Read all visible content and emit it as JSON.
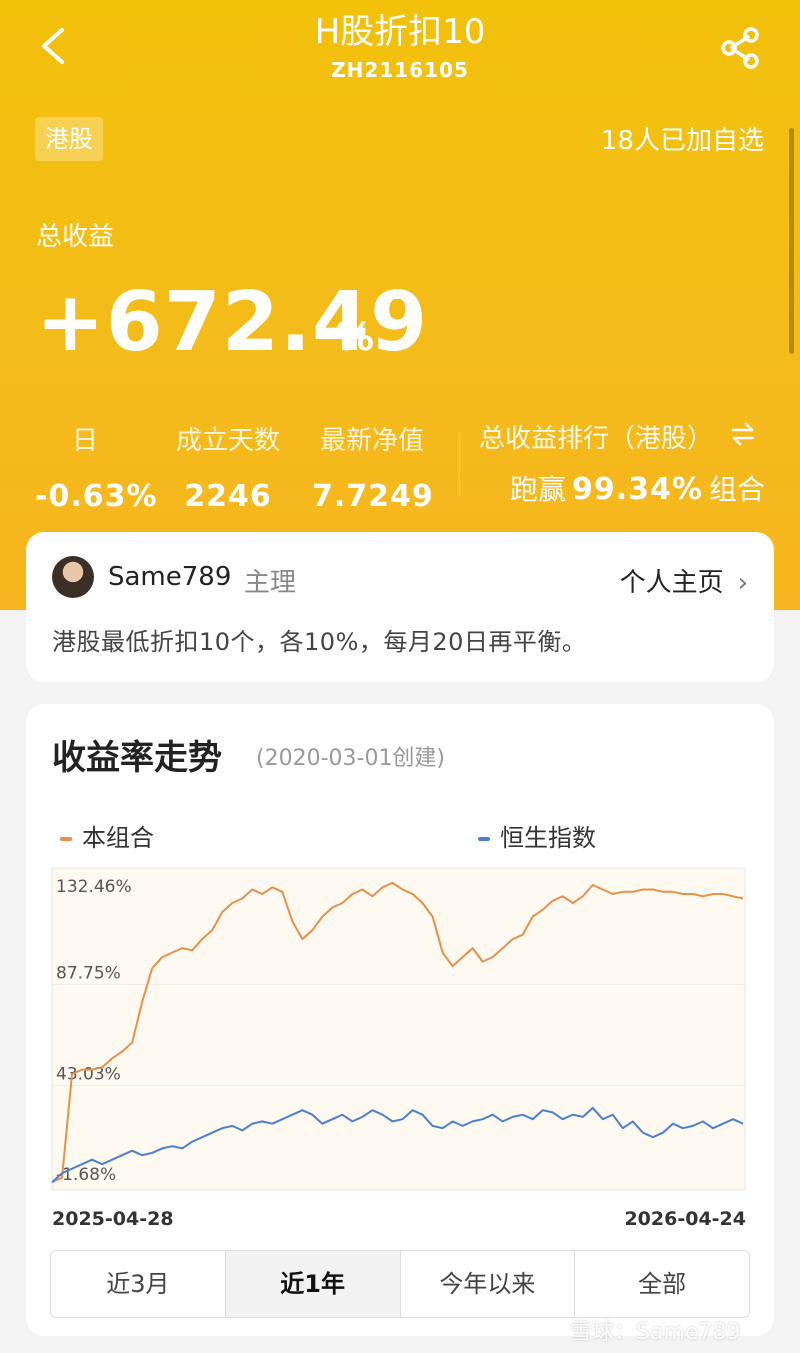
{
  "header": {
    "title": "H股折扣10",
    "code": "ZH2116105",
    "market_tag": "港股",
    "followers": "18人已加自选"
  },
  "summary": {
    "total_label": "总收益",
    "total_value": "+672.49",
    "total_unit": "%",
    "stats": [
      {
        "label": "日",
        "value": "-0.63%"
      },
      {
        "label": "成立天数",
        "value": "2246"
      },
      {
        "label": "最新净值",
        "value": "7.7249"
      }
    ],
    "rank_label": "总收益排行（港股）",
    "rank_prefix": "跑赢",
    "rank_value": "99.34%",
    "rank_suffix": "组合"
  },
  "manager": {
    "name": "Same789",
    "role": "主理",
    "home_link": "个人主页",
    "description": "港股最低折扣10个，各10%，每月20日再平衡。"
  },
  "chart_section": {
    "title": "收益率走势",
    "created": "(2020-03-01创建)",
    "tabs": [
      "近3月",
      "近1年",
      "今年以来",
      "全部"
    ],
    "active_tab": "近1年"
  },
  "colors": {
    "brand_yellow": "#f3bd12",
    "portfolio_line": "#e8904a",
    "index_line": "#4a7fd1"
  },
  "icons": [
    "back-arrow-icon",
    "share-icon",
    "swap-icon",
    "chevron-right-icon"
  ],
  "watermark": "雪球：Same789",
  "chart_data": {
    "type": "line",
    "title": "",
    "xlabel": "",
    "ylabel": "",
    "x_start": "2025-04-28",
    "x_end": "2026-04-24",
    "y_ticks": [
      "132.46%",
      "87.75%",
      "43.03%",
      "-1.68%"
    ],
    "ylim": [
      -1.68,
      132.46
    ],
    "legend_position": "top",
    "series": [
      {
        "name": "本组合",
        "values": [
          0,
          2,
          48,
          50,
          50,
          51,
          55,
          58,
          62,
          80,
          95,
          100,
          102,
          104,
          103,
          108,
          112,
          120,
          124,
          126,
          130,
          128,
          131,
          129,
          116,
          108,
          112,
          118,
          122,
          124,
          128,
          130,
          127,
          131,
          133,
          130,
          128,
          124,
          118,
          102,
          96,
          100,
          104,
          98,
          100,
          104,
          108,
          110,
          118,
          121,
          125,
          127,
          124,
          127,
          132,
          130,
          128,
          129,
          129,
          130,
          130,
          129,
          129,
          128,
          128,
          127,
          128,
          128,
          127,
          126
        ]
      },
      {
        "name": "恒生指数",
        "values": [
          0,
          4,
          6,
          8,
          10,
          8,
          10,
          12,
          14,
          12,
          13,
          15,
          16,
          15,
          18,
          20,
          22,
          24,
          25,
          23,
          26,
          27,
          26,
          28,
          30,
          32,
          30,
          26,
          28,
          30,
          27,
          29,
          32,
          30,
          27,
          28,
          32,
          30,
          25,
          24,
          27,
          25,
          27,
          28,
          30,
          27,
          29,
          30,
          28,
          32,
          31,
          28,
          30,
          29,
          33,
          28,
          30,
          24,
          27,
          22,
          20,
          22,
          26,
          24,
          25,
          27,
          24,
          26,
          28,
          26
        ]
      }
    ]
  }
}
